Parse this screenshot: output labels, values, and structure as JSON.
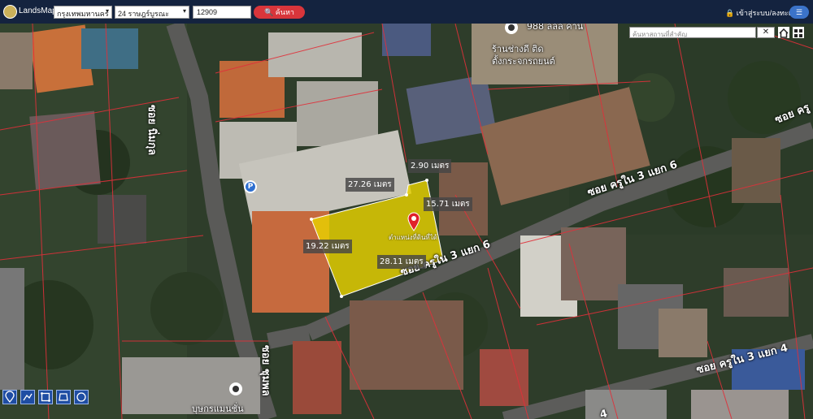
{
  "header": {
    "brand": "LandsMaps",
    "province": "กรุงเทพมหานคร",
    "district": "24 ราษฎร์บูรณะ",
    "parcel_no": "12909",
    "search_label": "🔍 ค้นหา",
    "login_label": "🔒 เข้าสู่ระบบ/ลงทะเบียน",
    "menu_label": "☰"
  },
  "map_search": {
    "placeholder": "ค้นหาสถานที่สำคัญ",
    "clear_label": "✕"
  },
  "parcel": {
    "name": "ตำแหน่งที่ดินที่ได้",
    "highlight_color": "#f2d800",
    "measurements": {
      "top": "27.26 เมตร",
      "top_right": "2.90 เมตร",
      "right": "15.71 เมตร",
      "left": "19.22 เมตร",
      "bottom": "28.11 เมตร"
    }
  },
  "roads": {
    "soi_nimkul": "ซอย นิ่มกุล",
    "kru_nai_3_6_upper": "ซอย ครูใน 3 แยก 6",
    "kru_nai_3_6_lower": "ซอย ครูใน 3 แยก 6",
    "kru_nai_3_4": "ซอย ครูใน 3 แยก 4",
    "soi_kru_right": "ซอย ครู",
    "soi_chumpon": "ซอย ชุมพล",
    "soi_4": "4"
  },
  "places": {
    "shop_address": "988 ลลล คาน",
    "shop_line1": "ร้านช่างดี ติด",
    "shop_line2": "ตั้งกระจกรถยนต์",
    "bottom_place": "บุษกรแมนชั่น",
    "parking_label": "P"
  },
  "icons": {
    "logo": "landsmaps-logo",
    "pin": "location-pin-icon",
    "tools": [
      "location-tool-icon",
      "measure-tool-icon",
      "area-tool-icon",
      "polygon-tool-icon",
      "circle-tool-icon"
    ]
  }
}
